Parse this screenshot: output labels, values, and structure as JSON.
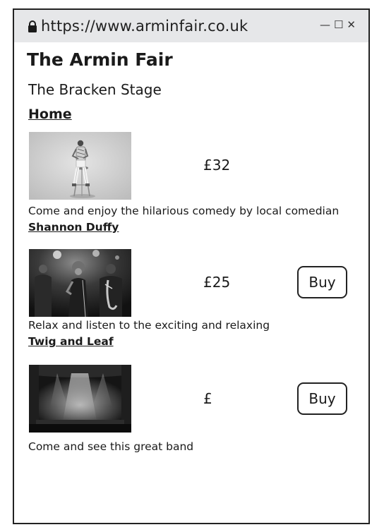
{
  "browser": {
    "url": "https://www.arminfair.co.uk",
    "controls": {
      "minimize": "—",
      "maximize": "☐",
      "close": "✕"
    }
  },
  "page": {
    "title": "The Armin Fair",
    "stage": "The Bracken Stage",
    "home_link": "Home"
  },
  "events": [
    {
      "price": "£32",
      "description": "Come and enjoy the hilarious comedy by local comedian",
      "performer": "Shannon Duffy",
      "buy_label": "",
      "image": "comedian-on-stool-photo"
    },
    {
      "price": "£25",
      "description": "Relax and listen to the exciting and relaxing",
      "performer": "Twig and Leaf",
      "buy_label": "Buy",
      "image": "jazz-band-photo"
    },
    {
      "price": "£",
      "description": "Come and see this great band",
      "performer": "",
      "buy_label": "Buy",
      "image": "empty-stage-photo"
    }
  ]
}
